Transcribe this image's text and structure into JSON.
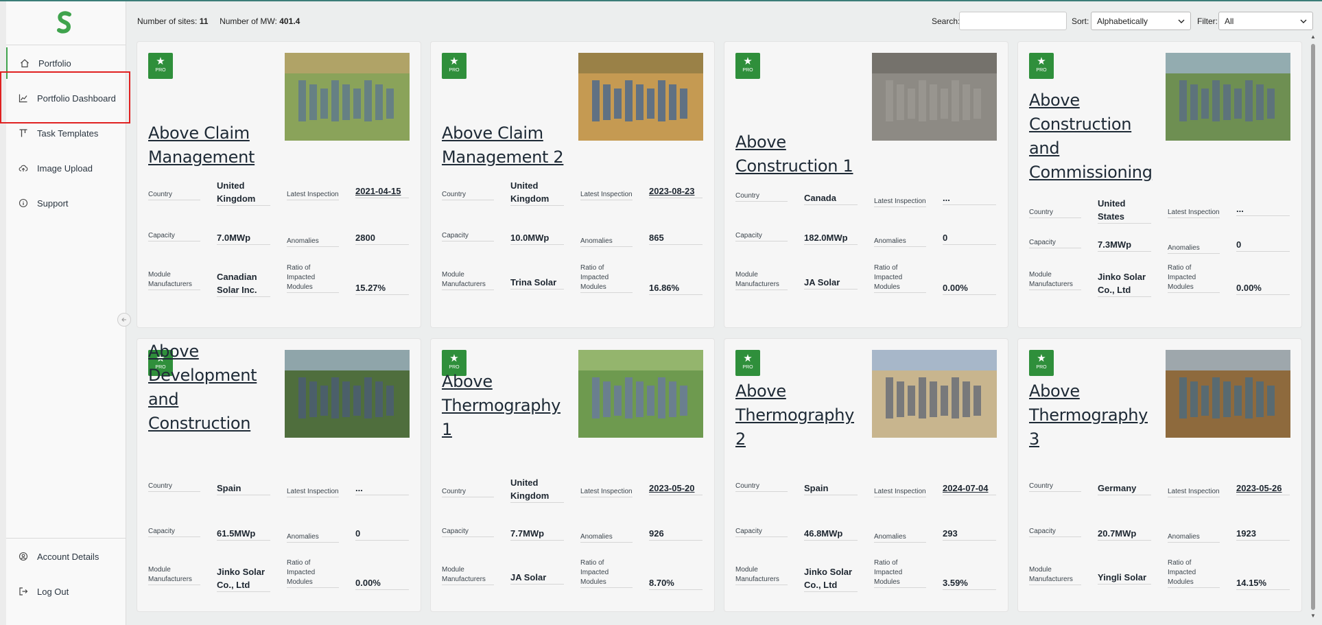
{
  "app": {
    "logo": "s-logo-icon",
    "accent": "#3fa34d",
    "brand_green": "#2f8f3b"
  },
  "sidebar": {
    "items": [
      {
        "label": "Portfolio",
        "icon": "home-icon"
      },
      {
        "label": "Portfolio Dashboard",
        "icon": "chart-icon"
      },
      {
        "label": "Task Templates",
        "icon": "template-icon"
      },
      {
        "label": "Image Upload",
        "icon": "cloud-upload-icon"
      },
      {
        "label": "Support",
        "icon": "info-icon"
      }
    ],
    "bottom_items": [
      {
        "label": "Account Details",
        "icon": "user-circle-icon"
      },
      {
        "label": "Log Out",
        "icon": "logout-icon"
      }
    ]
  },
  "header": {
    "sites_label": "Number of sites:",
    "sites_value": "11",
    "mw_label": "Number of MW:",
    "mw_value": "401.4",
    "search_label": "Search:",
    "search_value": "",
    "sort_label": "Sort:",
    "sort_value": "Alphabetically",
    "filter_label": "Filter:",
    "filter_value": "All"
  },
  "labels": {
    "country": "Country",
    "latest_inspection": "Latest Inspection",
    "capacity": "Capacity",
    "anomalies": "Anomalies",
    "module_manufacturers": "Module Manufacturers",
    "ratio": "Ratio of Impacted Modules",
    "pro": "PRO"
  },
  "cards": [
    {
      "title": "Above Claim Management",
      "country": "United Kingdom",
      "inspection": "2021-04-15",
      "capacity": "7.0MWp",
      "anomalies": "2800",
      "manufacturer": "Canadian Solar Inc.",
      "ratio": "15.27%"
    },
    {
      "title": "Above Claim Management 2",
      "country": "United Kingdom",
      "inspection": "2023-08-23",
      "capacity": "10.0MWp",
      "anomalies": "865",
      "manufacturer": "Trina Solar",
      "ratio": "16.86%"
    },
    {
      "title": "Above Construction 1",
      "country": "Canada",
      "inspection": "...",
      "capacity": "182.0MWp",
      "anomalies": "0",
      "manufacturer": "JA Solar",
      "ratio": "0.00%"
    },
    {
      "title": "Above Construction and Commissioning",
      "country": "United States",
      "inspection": "...",
      "capacity": "7.3MWp",
      "anomalies": "0",
      "manufacturer": "Jinko Solar Co., Ltd",
      "ratio": "0.00%"
    },
    {
      "title": "Above Development and Construction",
      "country": "Spain",
      "inspection": "...",
      "capacity": "61.5MWp",
      "anomalies": "0",
      "manufacturer": "Jinko Solar Co., Ltd",
      "ratio": "0.00%"
    },
    {
      "title": "Above Thermography 1",
      "country": "United Kingdom",
      "inspection": "2023-05-20",
      "capacity": "7.7MWp",
      "anomalies": "926",
      "manufacturer": "JA Solar",
      "ratio": "8.70%"
    },
    {
      "title": "Above Thermography 2",
      "country": "Spain",
      "inspection": "2024-07-04",
      "capacity": "46.8MWp",
      "anomalies": "293",
      "manufacturer": "Jinko Solar Co., Ltd",
      "ratio": "3.59%"
    },
    {
      "title": "Above Thermography 3",
      "country": "Germany",
      "inspection": "2023-05-26",
      "capacity": "20.7MWp",
      "anomalies": "1923",
      "manufacturer": "Yingli Solar",
      "ratio": "14.15%"
    }
  ]
}
